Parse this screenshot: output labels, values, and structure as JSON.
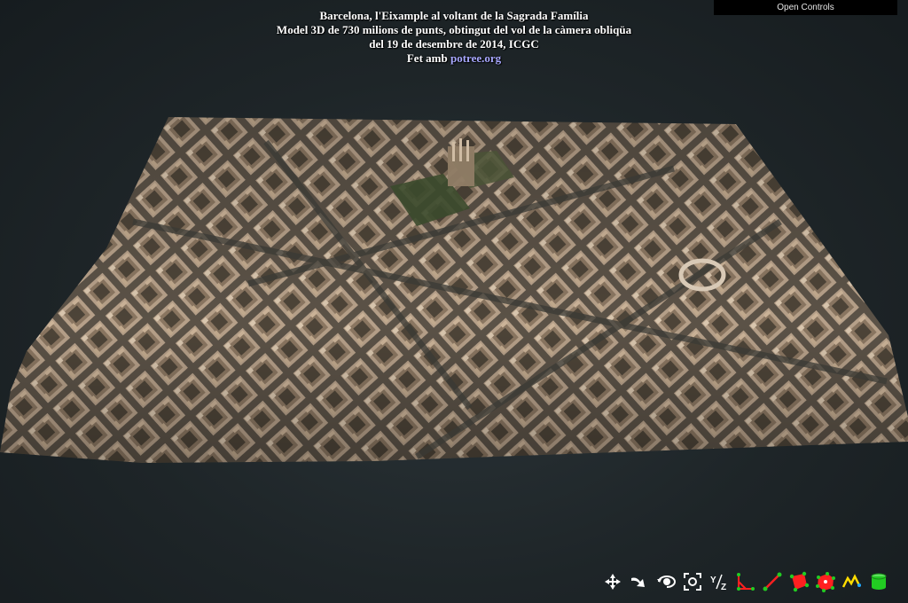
{
  "header": {
    "line1": "Barcelona, l'Eixample al voltant de la Sagrada Família",
    "line2": "Model 3D de 730 milions de punts, obtingut del vol de la càmera obliqüa",
    "line3": "del 19 de desembre de 2014, ICGC",
    "line4_prefix": "Fet amb ",
    "line4_link": "potree.org"
  },
  "controls": {
    "open_label": "Open Controls"
  },
  "toolbar": {
    "items": [
      {
        "icon": "earth-controls-icon"
      },
      {
        "icon": "fly-controls-icon"
      },
      {
        "icon": "orbit-controls-icon"
      },
      {
        "icon": "focus-icon"
      },
      {
        "icon": "flip-y-z-icon",
        "label": "Y/Z"
      },
      {
        "icon": "angle-measure-icon"
      },
      {
        "icon": "distance-measure-icon"
      },
      {
        "icon": "area-measure-icon"
      },
      {
        "icon": "volume-measure-icon"
      },
      {
        "icon": "height-profile-icon"
      },
      {
        "icon": "clip-volume-icon"
      }
    ]
  },
  "colors": {
    "background": "#1e2528",
    "title_text": "#ffffff",
    "link": "#a8a8ff",
    "measure_red": "#ff2020",
    "measure_green": "#22cc22",
    "profile_yellow": "#ffdd00"
  }
}
